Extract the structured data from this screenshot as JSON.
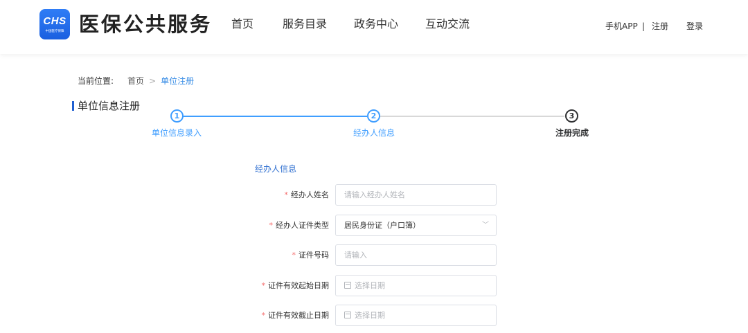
{
  "header": {
    "logo_text": "CHS",
    "logo_sub": "中国医疗保障",
    "site_title": "医保公共服务",
    "nav": [
      "首页",
      "服务目录",
      "政务中心",
      "互动交流"
    ],
    "links": {
      "app": "手机APP",
      "separator": "|",
      "register": "注册",
      "login": "登录"
    }
  },
  "breadcrumb": {
    "label": "当前位置:",
    "home": "首页",
    "arrow": ">",
    "current": "单位注册"
  },
  "section_title": "单位信息注册",
  "steps": [
    {
      "number": "1",
      "label": "单位信息录入"
    },
    {
      "number": "2",
      "label": "经办人信息"
    },
    {
      "number": "3",
      "label": "注册完成"
    }
  ],
  "form": {
    "heading": "经办人信息",
    "required_mark": "*",
    "fields": [
      {
        "label": "经办人姓名",
        "placeholder": "请输入经办人姓名",
        "value": ""
      },
      {
        "label": "经办人证件类型",
        "placeholder": "",
        "value": "居民身份证（户口簿）"
      },
      {
        "label": "证件号码",
        "placeholder": "请输入",
        "value": ""
      },
      {
        "label": "证件有效起始日期",
        "placeholder": "选择日期",
        "value": ""
      },
      {
        "label": "证件有效截止日期",
        "placeholder": "选择日期",
        "value": ""
      }
    ],
    "dropdown_glyph": "﹀"
  },
  "colors": {
    "accent": "#409eff",
    "brand": "#1f5fd1",
    "required": "#f56c6c"
  }
}
